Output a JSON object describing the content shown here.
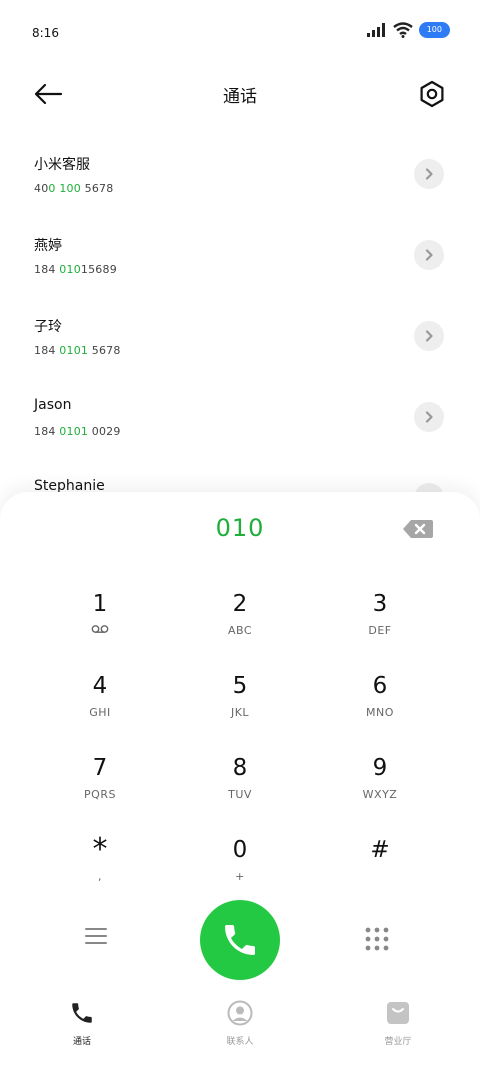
{
  "status": {
    "time": "8:16",
    "battery": "100"
  },
  "header": {
    "title": "通话"
  },
  "contacts": [
    {
      "name": "小米客服",
      "number_parts": [
        "40",
        "0",
        " ",
        "100",
        " 5678"
      ]
    },
    {
      "name": "燕婷",
      "number_parts": [
        "184 ",
        "010",
        "15689",
        "",
        ""
      ]
    },
    {
      "name": "子玲",
      "number_parts": [
        "184 ",
        "0101",
        " 5678",
        "",
        ""
      ]
    },
    {
      "name": "Jason",
      "number_parts": [
        "184 ",
        "0101",
        " 0029",
        "",
        ""
      ]
    },
    {
      "name": "Stephanie",
      "number_parts": [
        "",
        "",
        "",
        "",
        ""
      ]
    }
  ],
  "dialer": {
    "input": "010",
    "keys": [
      {
        "digit": "1",
        "sub": ""
      },
      {
        "digit": "2",
        "sub": "ABC"
      },
      {
        "digit": "3",
        "sub": "DEF"
      },
      {
        "digit": "4",
        "sub": "GHI"
      },
      {
        "digit": "5",
        "sub": "JKL"
      },
      {
        "digit": "6",
        "sub": "MNO"
      },
      {
        "digit": "7",
        "sub": "PQRS"
      },
      {
        "digit": "8",
        "sub": "TUV"
      },
      {
        "digit": "9",
        "sub": "WXYZ"
      },
      {
        "digit": "*",
        "sub": ","
      },
      {
        "digit": "0",
        "sub": "+"
      },
      {
        "digit": "#",
        "sub": ""
      }
    ]
  },
  "nav": [
    {
      "label": "通话",
      "icon": "phone-icon"
    },
    {
      "label": "联系人",
      "icon": "contact-icon"
    },
    {
      "label": "营业厅",
      "icon": "store-icon"
    }
  ],
  "colors": {
    "accent": "#1fae3a",
    "call_button": "#23c943",
    "battery": "#2f7bf6"
  }
}
